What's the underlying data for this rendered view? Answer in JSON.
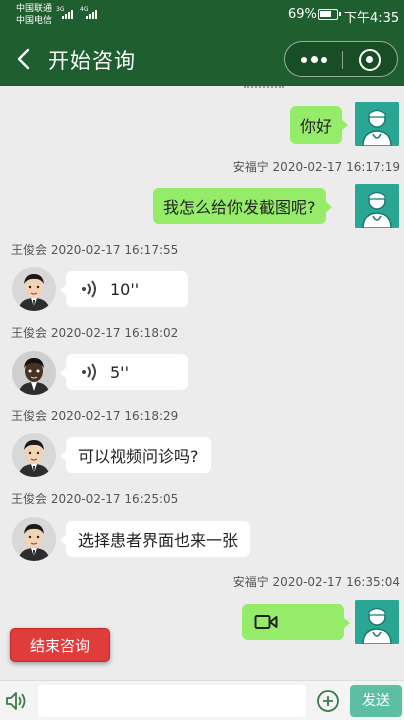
{
  "status_bar": {
    "carrier_1": "中国联通",
    "carrier_2": "中国电信",
    "net_1": "3G",
    "net_2": "4G",
    "battery": "69%",
    "time": "下午4:35"
  },
  "header": {
    "title": "开始咨询",
    "back_icon": "chevron-left-icon",
    "more_icon": "more-dots-icon",
    "close_icon": "mini-program-close-icon"
  },
  "messages": [
    {
      "id": 1,
      "sender": "self",
      "kind": "text",
      "text": "你好"
    },
    {
      "id": 2,
      "sender": "self",
      "kind": "text",
      "meta": "安福宁 2020-02-17 16:17:19",
      "text": "我怎么给你发截图呢?"
    },
    {
      "id": 3,
      "sender": "doctor",
      "kind": "voice",
      "meta": "王俊会 2020-02-17 16:17:55",
      "text": "10''"
    },
    {
      "id": 4,
      "sender": "doctor",
      "kind": "voice",
      "meta": "王俊会 2020-02-17 16:18:02",
      "text": "5''"
    },
    {
      "id": 5,
      "sender": "doctor",
      "kind": "text",
      "meta": "王俊会 2020-02-17 16:18:29",
      "text": "可以视频问诊吗?"
    },
    {
      "id": 6,
      "sender": "doctor",
      "kind": "text",
      "meta": "王俊会 2020-02-17 16:25:05",
      "text": "选择患者界面也来一张"
    },
    {
      "id": 7,
      "sender": "self",
      "kind": "video",
      "meta": "安福宁 2020-02-17 16:35:04",
      "icon": "video-call-icon"
    }
  ],
  "actions": {
    "end_consult": "结束咨询"
  },
  "input_bar": {
    "voice_icon": "speaker-icon",
    "placeholder": "",
    "plus_icon": "plus-circle-icon",
    "send": "发送"
  },
  "colors": {
    "header": "#1e5e2f",
    "bubble_self": "#95ec69",
    "bubble_other": "#ffffff",
    "end_button": "#e03c3c",
    "send_button": "#5cbfa4"
  }
}
